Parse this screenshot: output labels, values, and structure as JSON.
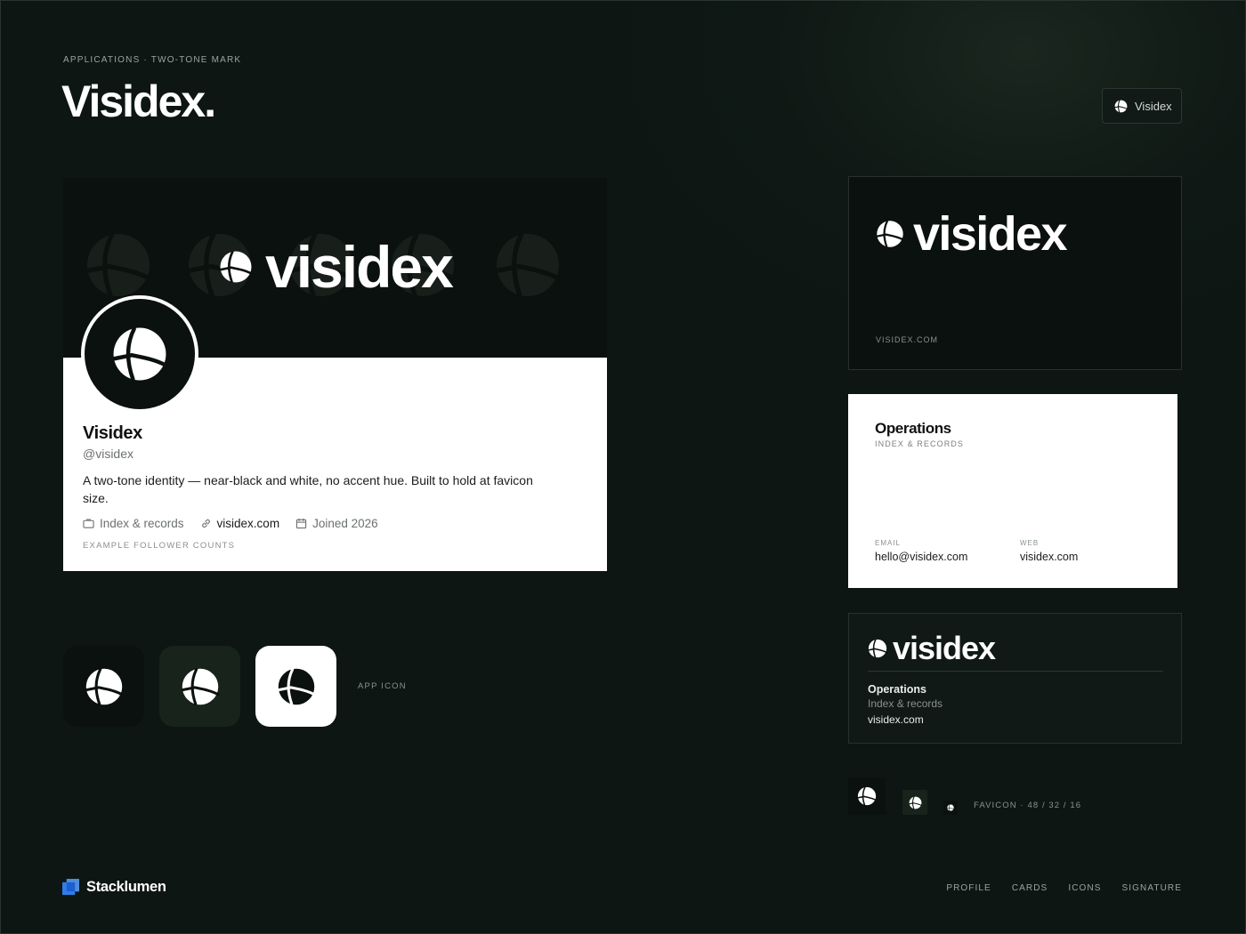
{
  "header": {
    "eyebrow": "APPLICATIONS · TWO-TONE MARK",
    "title": "Visidex.",
    "chip_label": "Visidex"
  },
  "icons": {
    "logo": "visidex-globe-mark",
    "briefcase": "briefcase-icon",
    "link": "link-icon",
    "calendar": "calendar-icon"
  },
  "profile": {
    "banner_wordmark": "visidex",
    "name": "Visidex",
    "handle": "@visidex",
    "bio": "A two-tone identity — near-black and white, no accent hue. Built to hold at favicon size.",
    "category": "Index & records",
    "website": "visidex.com",
    "joined": "Joined 2026",
    "caption": "EXAMPLE FOLLOWER COUNTS"
  },
  "app_icons": {
    "label": "APP ICON",
    "variants": [
      "dark",
      "green",
      "light"
    ]
  },
  "cards": {
    "dark": {
      "wordmark": "visidex",
      "url": "VISIDEX.COM"
    },
    "light": {
      "title": "Operations",
      "subtitle": "INDEX & RECORDS",
      "email_label": "EMAIL",
      "email": "hello@visidex.com",
      "web_label": "WEB",
      "web": "visidex.com"
    }
  },
  "signature": {
    "wordmark": "visidex",
    "role": "Operations",
    "team": "Index & records",
    "url": "visidex.com"
  },
  "favicon": {
    "label": "FAVICON · 48 / 32 / 16"
  },
  "footer": {
    "brand": "Stacklumen",
    "nav": [
      "PROFILE",
      "CARDS",
      "ICONS",
      "SIGNATURE"
    ]
  },
  "colors": {
    "background": "#0d1613",
    "near_black": "#0b110e",
    "white": "#ffffff",
    "brand_blue": "#2f7de8"
  }
}
